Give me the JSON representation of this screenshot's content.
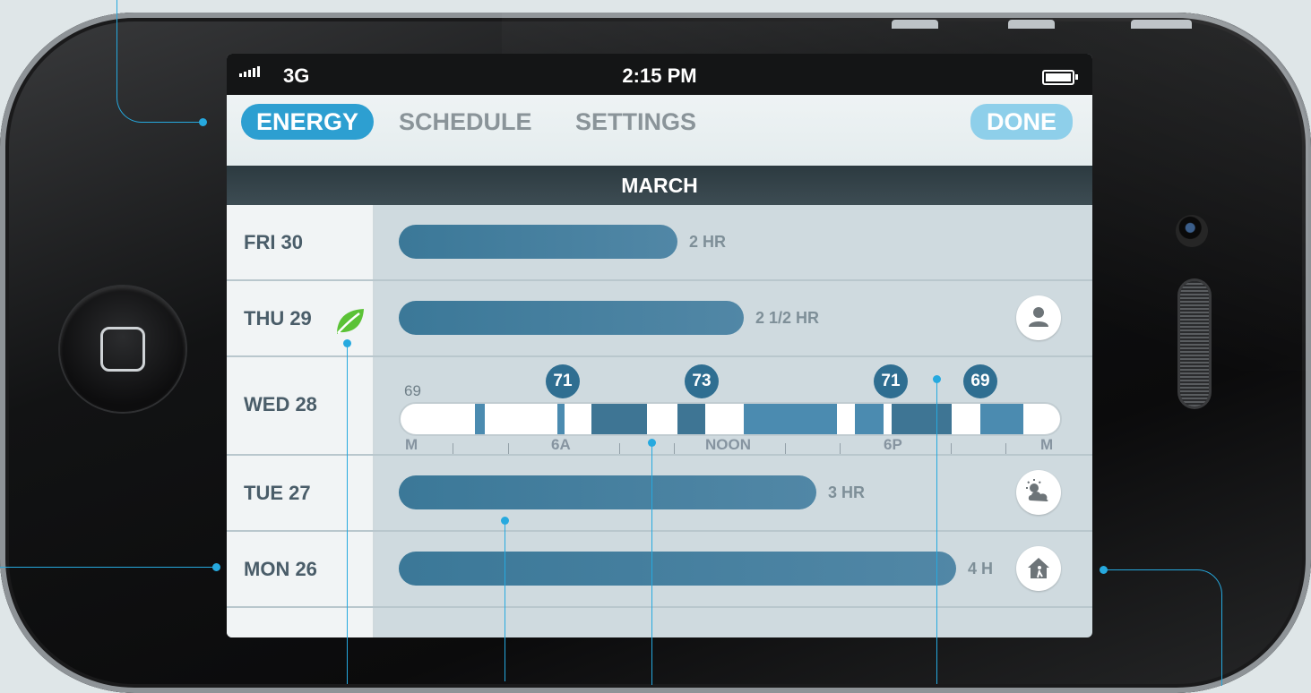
{
  "status": {
    "network": "3G",
    "time": "2:15 PM"
  },
  "nav": {
    "tabs": [
      {
        "label": "ENERGY",
        "active": true
      },
      {
        "label": "SCHEDULE",
        "active": false
      },
      {
        "label": "SETTINGS",
        "active": false
      }
    ],
    "done_label": "DONE"
  },
  "month": "MARCH",
  "days": [
    {
      "label": "FRI 30",
      "duration": "2 HR",
      "usage_fraction": 0.42,
      "icon": null,
      "leaf": false
    },
    {
      "label": "THU 29",
      "duration": "2 1/2 HR",
      "usage_fraction": 0.52,
      "icon": "person-icon",
      "leaf": true
    },
    {
      "label": "WED 28",
      "expanded": true
    },
    {
      "label": "TUE 27",
      "duration": "3 HR",
      "usage_fraction": 0.63,
      "icon": "weather-icon",
      "leaf": false
    },
    {
      "label": "MON 26",
      "duration": "4 H",
      "usage_fraction": 0.84,
      "icon": "home-away-icon",
      "leaf": false
    }
  ],
  "detail": {
    "start_temp": "69",
    "setpoints": [
      "71",
      "73",
      "71",
      "69"
    ],
    "axis_labels": [
      "M",
      "6A",
      "NOON",
      "6P",
      "M"
    ]
  },
  "colors": {
    "accent": "#2d9fd1",
    "bar": "#4a84a4",
    "done": "#8ecfea",
    "leaf": "#5bc236",
    "callout": "#26a9df"
  }
}
